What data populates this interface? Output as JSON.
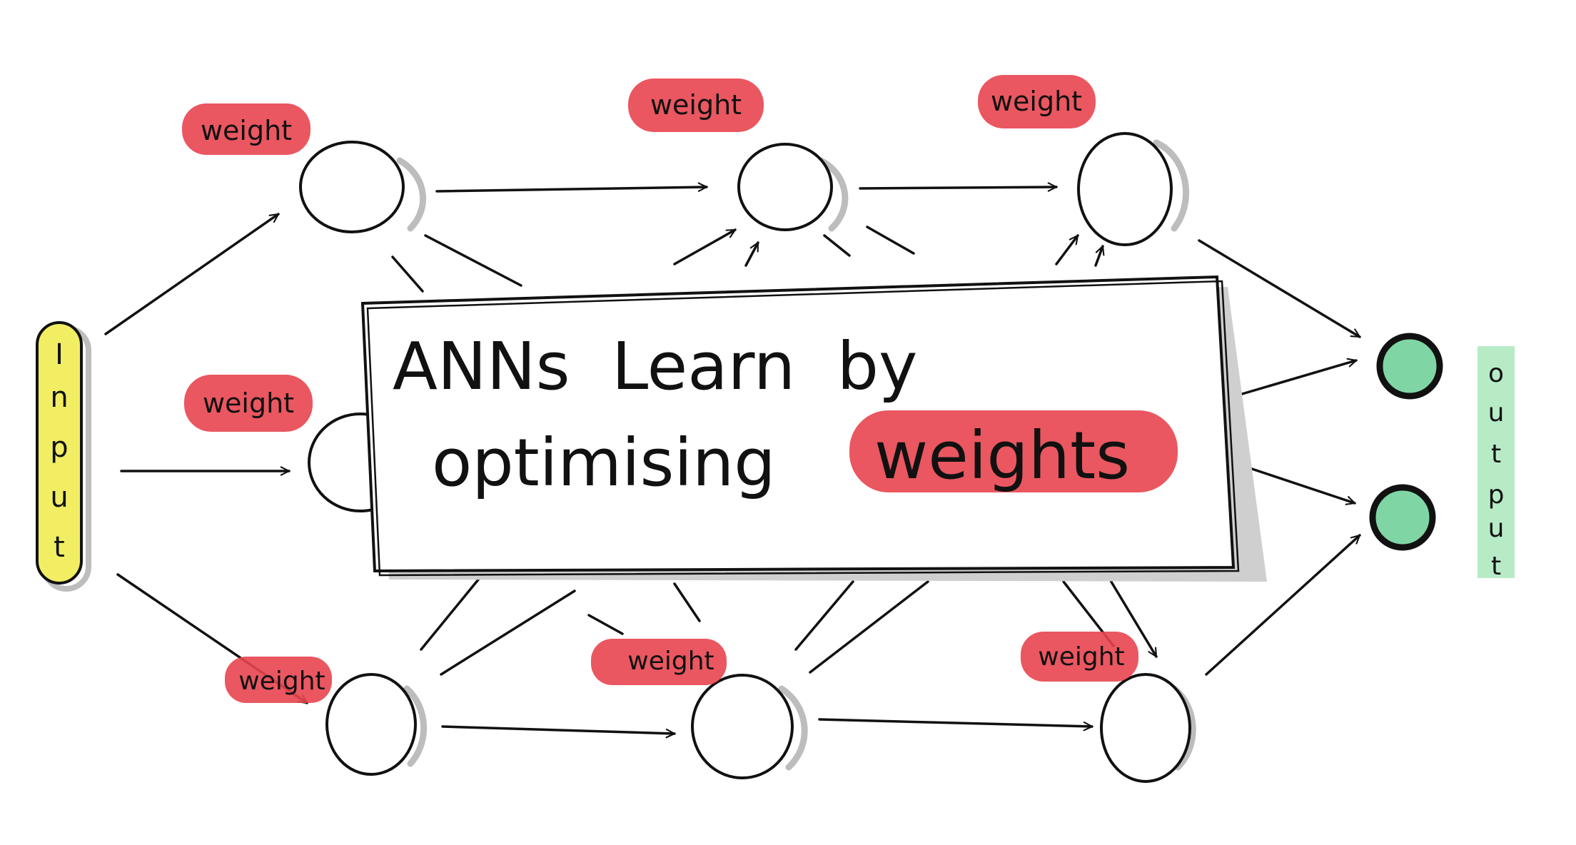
{
  "input_label": [
    "I",
    "n",
    "p",
    "u",
    "t"
  ],
  "output_label": [
    "o",
    "u",
    "t",
    "p",
    "u",
    "t"
  ],
  "weight_tag": "weight",
  "banner": {
    "line1": "ANNs  Learn  by",
    "line2_prefix": "optimising",
    "line2_highlight": "weights"
  },
  "colors": {
    "weight_highlight": "#e8454f",
    "input_highlight": "#f1ee64",
    "output_highlight": "#b6ebc6",
    "output_node_fill": "#7fd6a4",
    "ink": "#111111"
  }
}
